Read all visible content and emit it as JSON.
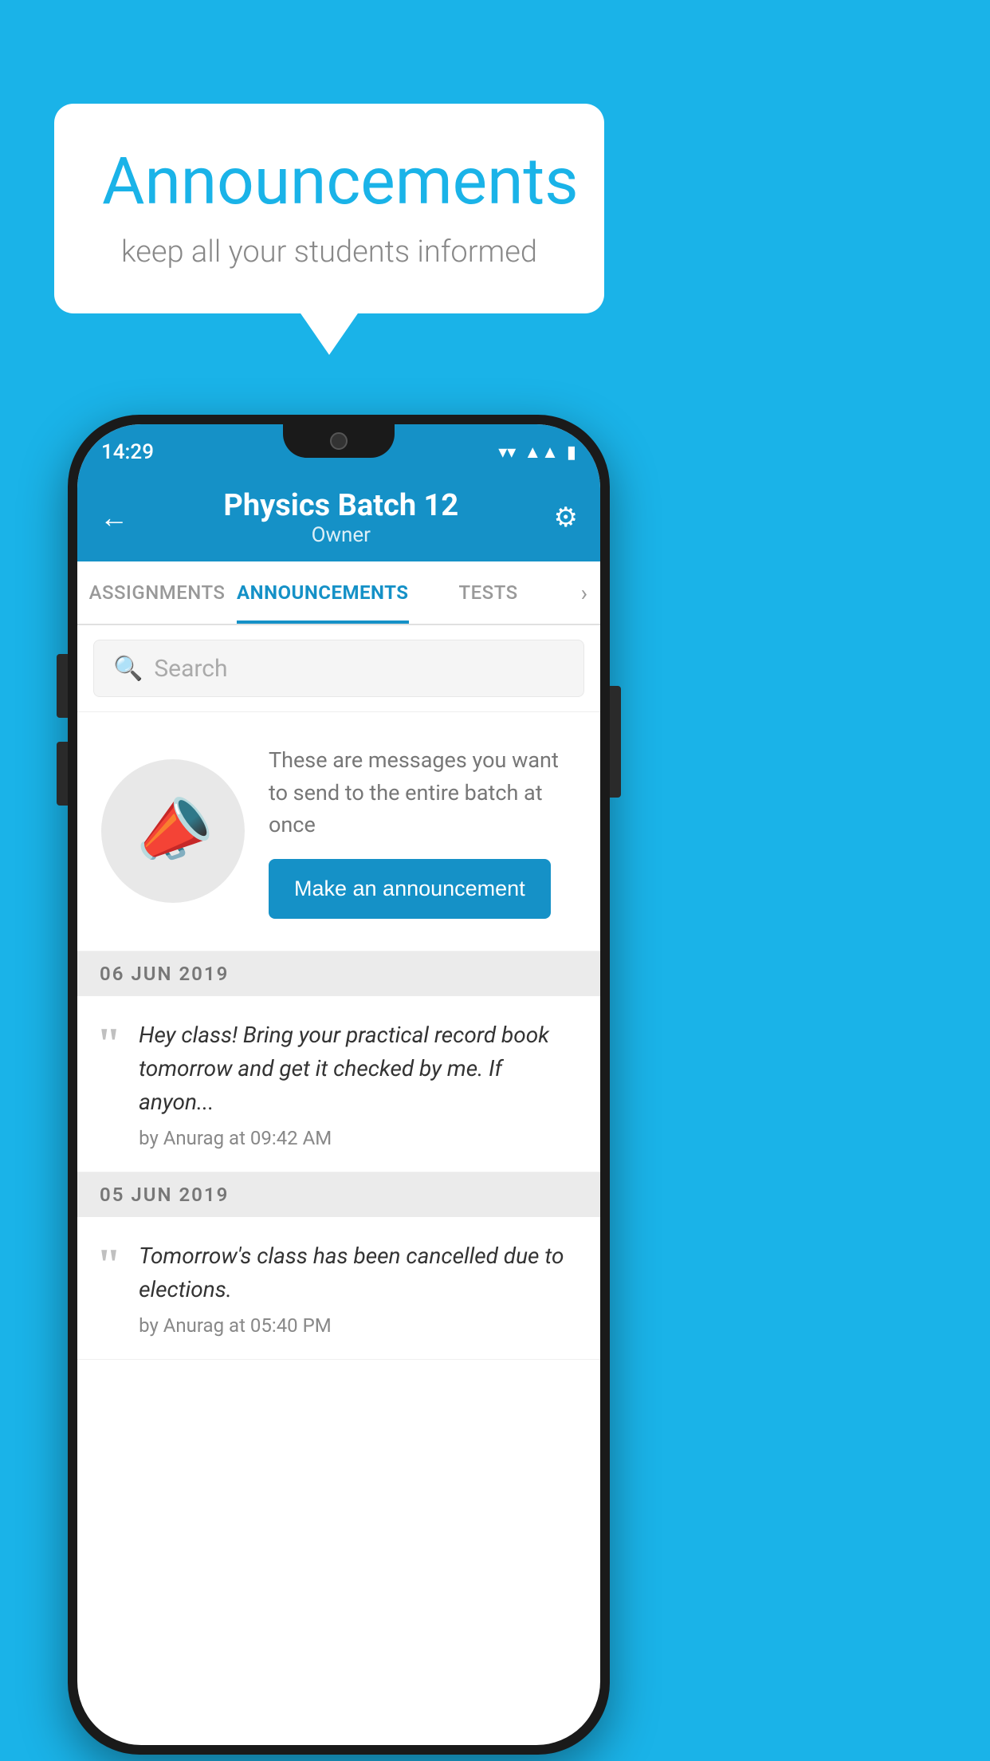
{
  "background": {
    "color": "#1ab3e8"
  },
  "speech_bubble": {
    "title": "Announcements",
    "subtitle": "keep all your students informed"
  },
  "phone": {
    "status_bar": {
      "time": "14:29"
    },
    "header": {
      "title": "Physics Batch 12",
      "subtitle": "Owner",
      "back_label": "←",
      "settings_label": "⚙"
    },
    "tabs": [
      {
        "label": "ASSIGNMENTS",
        "active": false
      },
      {
        "label": "ANNOUNCEMENTS",
        "active": true
      },
      {
        "label": "TESTS",
        "active": false
      }
    ],
    "search": {
      "placeholder": "Search"
    },
    "announcement_prompt": {
      "description": "These are messages you want to send to the entire batch at once",
      "button_label": "Make an announcement"
    },
    "announcements": [
      {
        "date": "06  JUN  2019",
        "text": "Hey class! Bring your practical record book tomorrow and get it checked by me. If anyon...",
        "by": "by Anurag at 09:42 AM"
      },
      {
        "date": "05  JUN  2019",
        "text": "Tomorrow's class has been cancelled due to elections.",
        "by": "by Anurag at 05:40 PM"
      }
    ]
  }
}
